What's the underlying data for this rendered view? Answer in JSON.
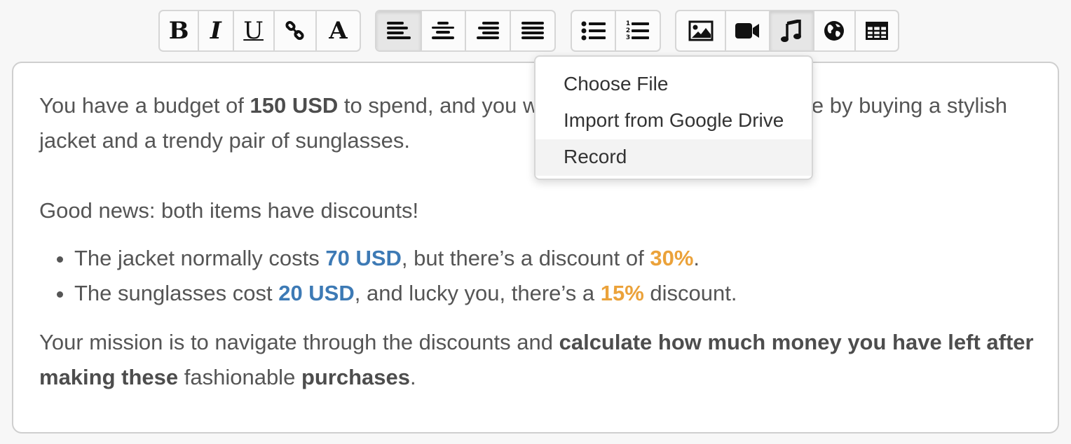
{
  "toolbar": {
    "formatting": [
      {
        "name": "bold",
        "label": "B",
        "icon": "bold-icon"
      },
      {
        "name": "italic",
        "label": "I",
        "icon": "italic-icon"
      },
      {
        "name": "underline",
        "label": "U",
        "icon": "underline-icon"
      },
      {
        "name": "link",
        "icon": "link-icon"
      },
      {
        "name": "font",
        "label": "A",
        "icon": "font-icon"
      }
    ],
    "alignment": [
      {
        "name": "align-left",
        "icon": "align-left-icon",
        "active": true
      },
      {
        "name": "align-center",
        "icon": "align-center-icon"
      },
      {
        "name": "align-right",
        "icon": "align-right-icon"
      },
      {
        "name": "align-justify",
        "icon": "align-justify-icon"
      }
    ],
    "lists": [
      {
        "name": "bulleted-list",
        "icon": "bulleted-list-icon"
      },
      {
        "name": "numbered-list",
        "icon": "numbered-list-icon",
        "numbers": [
          "1",
          "2",
          "3"
        ]
      }
    ],
    "insert": [
      {
        "name": "image",
        "icon": "image-icon"
      },
      {
        "name": "video",
        "icon": "video-icon"
      },
      {
        "name": "audio",
        "icon": "music-note-icon",
        "active": true
      },
      {
        "name": "embed",
        "icon": "globe-icon"
      },
      {
        "name": "table",
        "icon": "table-icon"
      }
    ]
  },
  "audio_menu": {
    "items": [
      {
        "label": "Choose File"
      },
      {
        "label": "Import from Google Drive"
      },
      {
        "label": "Record",
        "hovered": true
      }
    ]
  },
  "content": {
    "p1": {
      "t1": "You have a budget of ",
      "b1": "150 USD",
      "t2": " to spend, and you want to upgrade your wardrobe by buying a stylish jacket and a trendy pair of sunglasses."
    },
    "p2": "Good news: both items have discounts!",
    "bullets": [
      {
        "t1": "The jacket normally costs ",
        "price": "70 USD",
        "t2": ", but there’s a discount of ",
        "discount": "30%",
        "t3": "."
      },
      {
        "t1": "The sunglasses cost ",
        "price": "20 USD",
        "t2": ", and lucky you, there’s a ",
        "discount": "15%",
        "t3": " discount."
      }
    ],
    "p3": {
      "t1": "Your mission is to navigate through the discounts and ",
      "b1": "calculate how much money you have left after making these",
      "t2": " fashionable ",
      "b2": "purchases",
      "t3": "."
    }
  },
  "colors": {
    "price": "#3d7ab5",
    "discount": "#eba23a",
    "text": "#555555"
  }
}
